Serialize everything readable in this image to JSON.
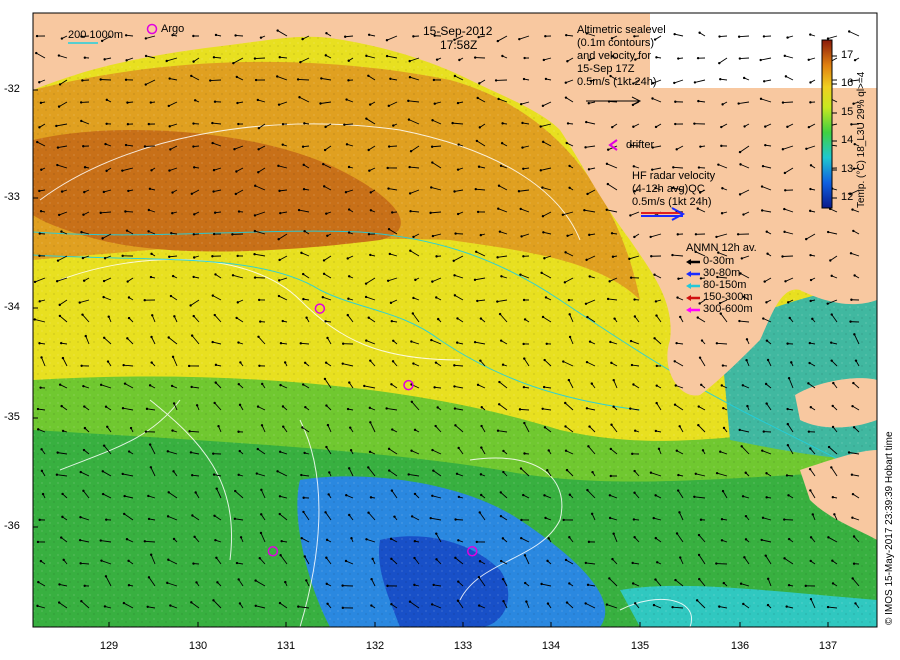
{
  "header": {
    "date": "15-Sep-2012",
    "time": "17:58Z"
  },
  "scale": {
    "text": "200  1000m",
    "argo_label": "Argo"
  },
  "altimetry": {
    "lines": [
      "Altimetric sealevel",
      "(0.1m contours)",
      "and velocity for",
      "15-Sep 17Z",
      "0.5m/s (1kt 24h)"
    ]
  },
  "drifter": {
    "label": "drifter"
  },
  "hf_radar": {
    "lines": [
      "HF radar velocity",
      "(4-12h avg)QC",
      "0.5m/s (1kt 24h)"
    ]
  },
  "anmn": {
    "title": "ANMN 12h av.",
    "items": [
      {
        "label": "0-30m",
        "color": "#000000"
      },
      {
        "label": "30-80m",
        "color": "#1a2bff"
      },
      {
        "label": "80-150m",
        "color": "#22c8d8"
      },
      {
        "label": "150-300m",
        "color": "#d01010"
      },
      {
        "label": "300-600m",
        "color": "#ff00ff"
      }
    ]
  },
  "colorbar": {
    "label": "Temp. (°C) 18_L3U 29% ql>=4",
    "ticks": [
      "17",
      "16",
      "15",
      "14",
      "13",
      "12"
    ]
  },
  "axes": {
    "lat_ticks": [
      "-32",
      "-33",
      "-34",
      "-35",
      "-36"
    ],
    "lon_ticks": [
      "129",
      "130",
      "131",
      "132",
      "133",
      "134",
      "135",
      "136",
      "137"
    ]
  },
  "credit": "© IMOS 15-May-2017 23:39:39 Hobart time",
  "colors": {
    "land": "#f8c8a0",
    "warm": "#d98a1a",
    "mid": "#f0e020",
    "cool": "#38c040",
    "cold": "#2080e0"
  },
  "argo_floats": [
    {
      "lon": 131.38,
      "lat": -34.0
    },
    {
      "lon": 132.38,
      "lat": -34.7
    },
    {
      "lon": 130.85,
      "lat": -36.22
    },
    {
      "lon": 133.1,
      "lat": -36.22
    }
  ]
}
